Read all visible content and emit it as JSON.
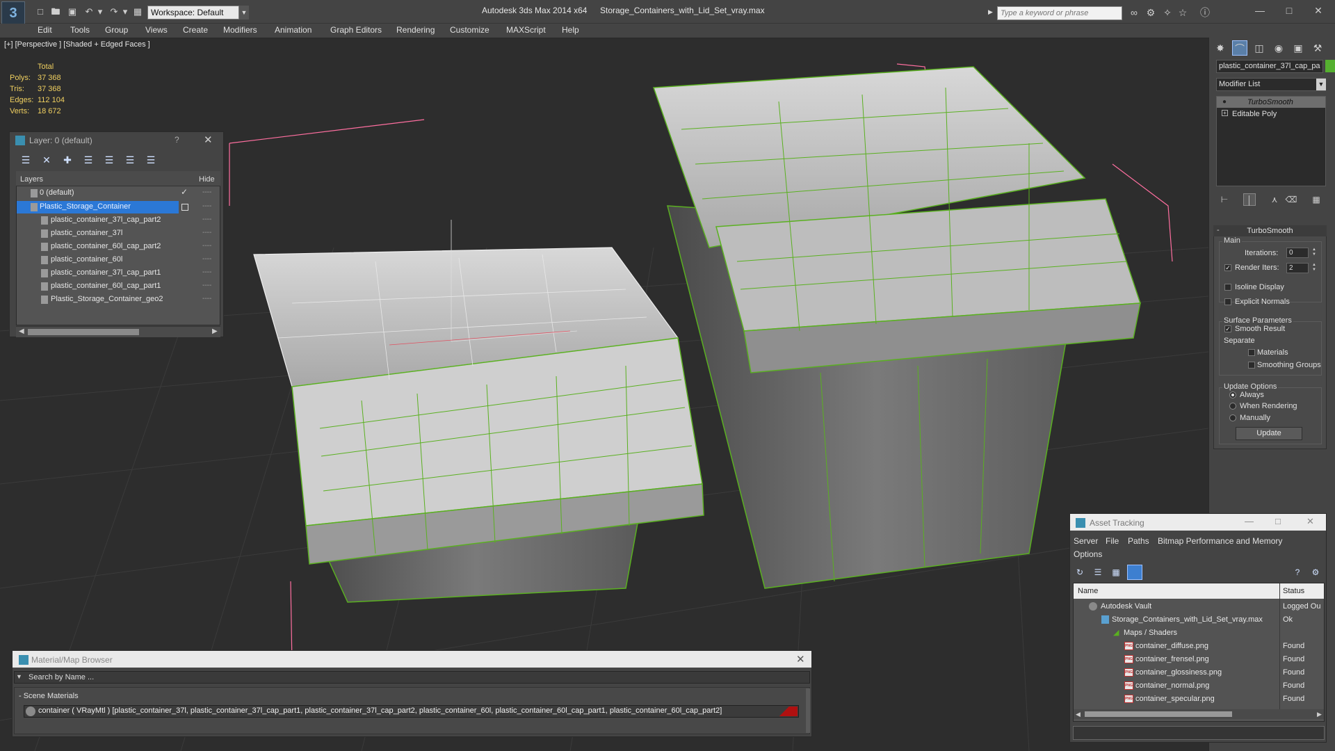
{
  "window": {
    "app_title": "Autodesk 3ds Max  2014 x64",
    "file_title": "Storage_Containers_with_Lid_Set_vray.max",
    "workspace": "Workspace: Default",
    "search_placeholder": "Type a keyword or phrase"
  },
  "menu": [
    "Edit",
    "Tools",
    "Group",
    "Views",
    "Create",
    "Modifiers",
    "Animation",
    "Graph Editors",
    "Rendering",
    "Customize",
    "MAXScript",
    "Help"
  ],
  "viewport": {
    "label": "[+] [Perspective ] [Shaded + Edged Faces ]",
    "stats": {
      "header": "Total",
      "rows": [
        {
          "k": "Polys:",
          "v": "37 368"
        },
        {
          "k": "Tris:",
          "v": "37 368"
        },
        {
          "k": "Edges:",
          "v": "112 104"
        },
        {
          "k": "Verts:",
          "v": "18 672"
        }
      ]
    }
  },
  "layer_panel": {
    "title": "Layer: 0 (default)",
    "help": "?",
    "col_layers": "Layers",
    "col_hide": "Hide",
    "rows": [
      {
        "name": "0 (default)",
        "hide": "----"
      },
      {
        "name": "Plastic_Storage_Container",
        "hide": "----"
      },
      {
        "name": "plastic_container_37l_cap_part2",
        "hide": "----"
      },
      {
        "name": "plastic_container_37l",
        "hide": "----"
      },
      {
        "name": "plastic_container_60l_cap_part2",
        "hide": "----"
      },
      {
        "name": "plastic_container_60l",
        "hide": "----"
      },
      {
        "name": "plastic_container_37l_cap_part1",
        "hide": "----"
      },
      {
        "name": "plastic_container_60l_cap_part1",
        "hide": "----"
      },
      {
        "name": "Plastic_Storage_Container_geo2",
        "hide": "----"
      }
    ]
  },
  "command_panel": {
    "object_name": "plastic_container_37l_cap_pa",
    "object_color": "#55b030",
    "modifier_list": "Modifier List",
    "stack": [
      "TurboSmooth",
      "Editable Poly"
    ],
    "rollout_title": "TurboSmooth",
    "main_group": "Main",
    "iterations_label": "Iterations:",
    "iterations_value": "0",
    "render_iters_label": "Render Iters:",
    "render_iters_value": "2",
    "isoline": "Isoline Display",
    "explicit_normals": "Explicit Normals",
    "surface_group": "Surface Parameters",
    "smooth_result": "Smooth Result",
    "separate": "Separate",
    "materials": "Materials",
    "smoothing_groups": "Smoothing Groups",
    "update_group": "Update Options",
    "always": "Always",
    "when_rendering": "When Rendering",
    "manually": "Manually",
    "update_button": "Update"
  },
  "material_browser": {
    "title": "Material/Map Browser",
    "search_placeholder": "Search by Name ...",
    "group": "- Scene Materials",
    "row": "container ( VRayMtl ) [plastic_container_37l, plastic_container_37l_cap_part1, plastic_container_37l_cap_part2, plastic_container_60l, plastic_container_60l_cap_part1, plastic_container_60l_cap_part2]"
  },
  "asset_tracking": {
    "title": "Asset Tracking",
    "menu": [
      "Server",
      "File",
      "Paths",
      "Bitmap Performance and Memory",
      "Options"
    ],
    "col_name": "Name",
    "col_status": "Status",
    "rows": [
      {
        "name": "Autodesk Vault",
        "status": "Logged Ou"
      },
      {
        "name": "Storage_Containers_with_Lid_Set_vray.max",
        "status": "Ok"
      },
      {
        "name": "Maps / Shaders",
        "status": ""
      },
      {
        "name": "container_diffuse.png",
        "status": "Found"
      },
      {
        "name": "container_frensel.png",
        "status": "Found"
      },
      {
        "name": "container_glossiness.png",
        "status": "Found"
      },
      {
        "name": "container_normal.png",
        "status": "Found"
      },
      {
        "name": "container_specular.png",
        "status": "Found"
      }
    ]
  },
  "colors": {
    "wire_green": "#5ab020",
    "selection_blue": "#2b78d6",
    "stats_yellow": "#f0d060"
  }
}
